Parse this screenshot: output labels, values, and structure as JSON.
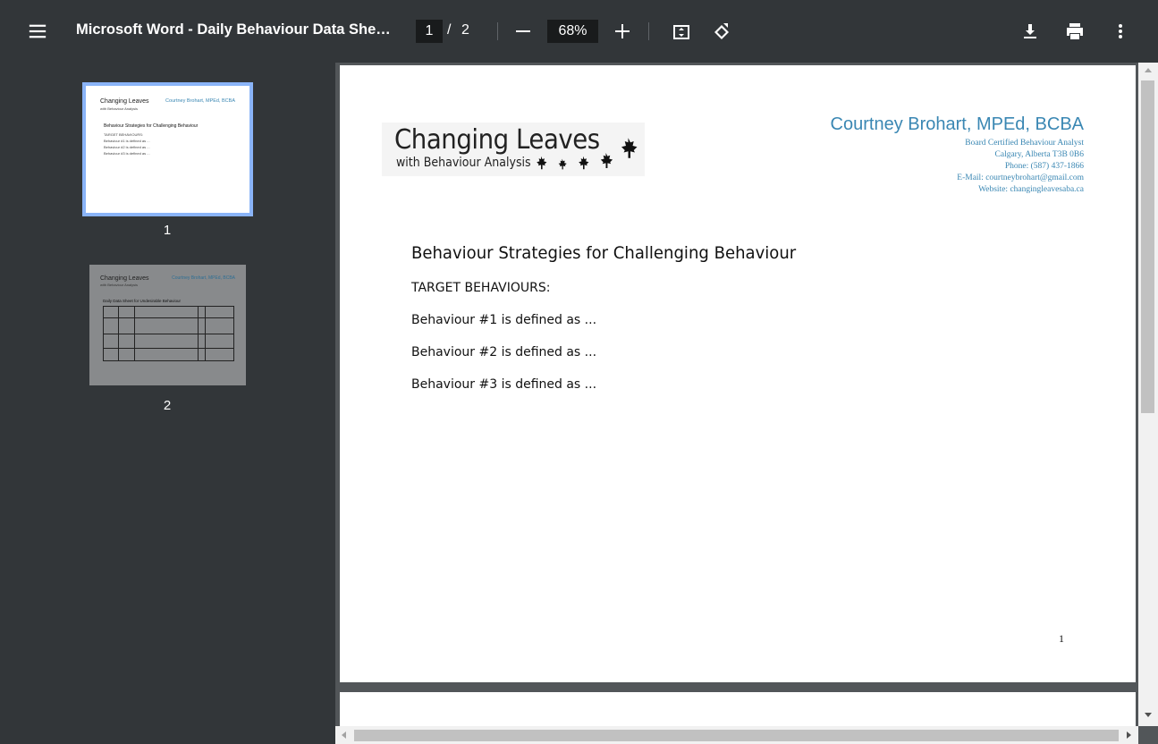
{
  "toolbar": {
    "title": "Microsoft Word - Daily Behaviour Data Sheet...",
    "current_page": "1",
    "page_separator": "/",
    "total_pages": "2",
    "zoom": "68%"
  },
  "sidebar": {
    "thumbnails": [
      {
        "label": "1"
      },
      {
        "label": "2"
      }
    ],
    "thumb1": {
      "logo": "Changing Leaves",
      "logo_sub": "with Behaviour Analysis",
      "name": "Courtney Brohart, MPEd, BCBA",
      "heading": "Behaviour Strategies for Challenging Behaviour",
      "lines": [
        "TARGET BEHAVIOURS:",
        "Behaviour #1 is defined as ...",
        "Behaviour #2 is defined as ...",
        "Behaviour #3 is defined as ..."
      ]
    },
    "thumb2": {
      "logo": "Changing Leaves",
      "logo_sub": "with Behaviour Analysis",
      "name": "Courtney Brohart, MPEd, BCBA",
      "heading": "Daily Data Sheet for Undesirable Behaviour"
    }
  },
  "document": {
    "logo_main": "Changing Leaves",
    "logo_sub": "with Behaviour Analysis",
    "name": "Courtney Brohart, MPEd, BCBA",
    "contact": [
      "Board Certified Behaviour Analyst",
      "Calgary, Alberta T3B 0B6",
      "Phone: (587) 437-1866",
      "E-Mail: courtneybrohart@gmail.com",
      "Website: changingleavesaba.ca"
    ],
    "heading": "Behaviour Strategies for Challenging Behaviour",
    "target_label": "TARGET BEHAVIOURS:",
    "behaviours": [
      "Behaviour #1 is defined as ...",
      "Behaviour #2 is defined as ...",
      "Behaviour #3 is defined as ..."
    ],
    "page_number": "1"
  },
  "colors": {
    "accent": "#3a87b3",
    "toolbar_bg": "#323639",
    "viewer_bg": "#525659",
    "selected_thumb_border": "#8ab4f8"
  },
  "icons": [
    "menu-icon",
    "minus-icon",
    "plus-icon",
    "fit-page-icon",
    "rotate-icon",
    "download-icon",
    "print-icon",
    "more-vert-icon",
    "maple-leaf-icon"
  ]
}
